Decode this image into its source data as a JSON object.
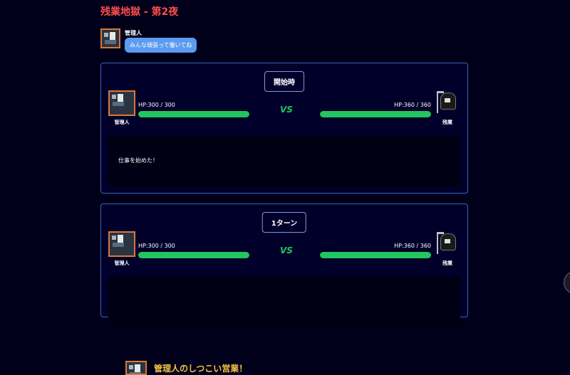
{
  "title": "残業地獄 - 第2夜",
  "speaker": {
    "name": "管理人",
    "message": "みんな頑張って働いてね",
    "avatar_icon": "admin-avatar-icon"
  },
  "panels": [
    {
      "label": "開始時",
      "left": {
        "name": "管理人",
        "hp_text": "HP:300 / 300",
        "hp": 300,
        "hp_max": 300,
        "icon": "admin-avatar-icon"
      },
      "right": {
        "name": "残業",
        "hp_text": "HP:360 / 360",
        "hp": 360,
        "hp_max": 360,
        "icon": "reaper-icon"
      },
      "vs": "VS",
      "log": "仕事を始めた！"
    },
    {
      "label": "1ターン",
      "left": {
        "name": "管理人",
        "hp_text": "HP:300 / 300",
        "hp": 300,
        "hp_max": 300,
        "icon": "admin-avatar-icon"
      },
      "right": {
        "name": "残業",
        "hp_text": "HP:360 / 360",
        "hp": 360,
        "hp_max": 360,
        "icon": "reaper-icon"
      },
      "vs": "VS",
      "log": "管理人のしつこい営業！"
    }
  ],
  "colors": {
    "background": "#00001a",
    "title": "#ff4d4d",
    "bubble": "#5b9bf0",
    "hp_bar": "#22c55e",
    "vs": "#22c55e",
    "border": "#3a64b8",
    "attack_text": "#f5c542"
  }
}
